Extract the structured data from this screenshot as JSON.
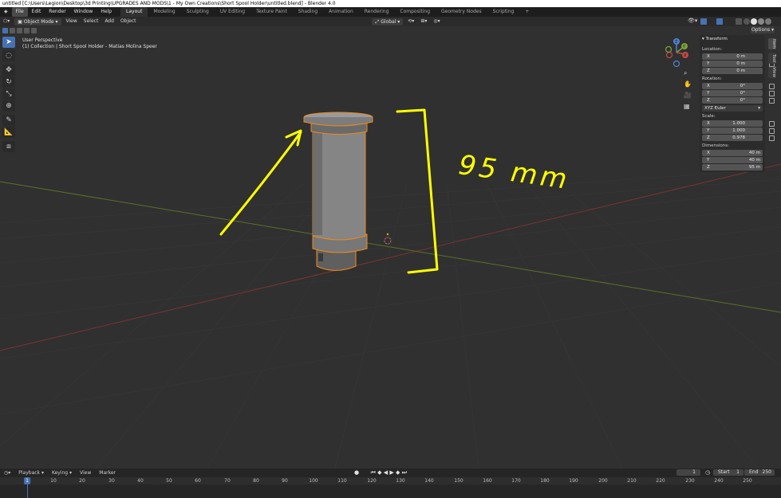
{
  "window": {
    "title": "untitled [C:\\Users\\Legion\\Desktop\\3d Printing\\UPGRADES AND MODS\\1 - My Own Creations\\Short Spool Holder\\untitled.blend] - Blender 4.0"
  },
  "menubar": {
    "menus": [
      "File",
      "Edit",
      "Render",
      "Window",
      "Help"
    ],
    "workspaces": [
      "Layout",
      "Modeling",
      "Sculpting",
      "UV Editing",
      "Texture Paint",
      "Shading",
      "Animation",
      "Rendering",
      "Compositing",
      "Geometry Nodes",
      "Scripting"
    ],
    "add_tab": "+"
  },
  "header": {
    "mode": "Object Mode",
    "menus": [
      "View",
      "Select",
      "Add",
      "Object"
    ],
    "orientation": "Global",
    "options_label": "Options"
  },
  "viewport": {
    "view_name": "User Perspective",
    "collection_line": "(1) Collection | Short Spool Holder - Matias Molina Speer",
    "annotation_text": "95 mm",
    "gizmo_axes": [
      "Z",
      "Y",
      "X"
    ]
  },
  "npanel": {
    "tabs": [
      "Item",
      "Tool",
      "View"
    ],
    "section_title": "Transform",
    "location_label": "Location:",
    "location": [
      {
        "axis": "X",
        "value": "0 m"
      },
      {
        "axis": "Y",
        "value": "0 m"
      },
      {
        "axis": "Z",
        "value": "0 m"
      }
    ],
    "rotation_label": "Rotation:",
    "rotation": [
      {
        "axis": "X",
        "value": "0°"
      },
      {
        "axis": "Y",
        "value": "0°"
      },
      {
        "axis": "Z",
        "value": "0°"
      }
    ],
    "rotation_mode": "XYZ Euler",
    "scale_label": "Scale:",
    "scale": [
      {
        "axis": "X",
        "value": "1.000"
      },
      {
        "axis": "Y",
        "value": "1.000"
      },
      {
        "axis": "Z",
        "value": "0.978"
      }
    ],
    "dimensions_label": "Dimensions:",
    "dimensions": [
      {
        "axis": "X",
        "value": "40 m"
      },
      {
        "axis": "Y",
        "value": "40 m"
      },
      {
        "axis": "Z",
        "value": "95 m"
      }
    ]
  },
  "timeline": {
    "menus": [
      "Playback",
      "Keying",
      "View",
      "Marker"
    ],
    "current_frame": "1",
    "start_label": "Start",
    "start_value": "1",
    "end_label": "End",
    "end_value": "250",
    "ruler_ticks": [
      "1",
      "10",
      "20",
      "30",
      "40",
      "50",
      "60",
      "70",
      "80",
      "90",
      "100",
      "110",
      "120",
      "130",
      "140",
      "150",
      "160",
      "170",
      "180",
      "190",
      "200",
      "210",
      "220",
      "230",
      "240",
      "250"
    ]
  },
  "colors": {
    "accent": "#4772b3",
    "annotation": "#ffff00",
    "selection_outline": "#f0891a",
    "x_axis": "#9b3a3a",
    "y_axis": "#6d8a2c"
  }
}
